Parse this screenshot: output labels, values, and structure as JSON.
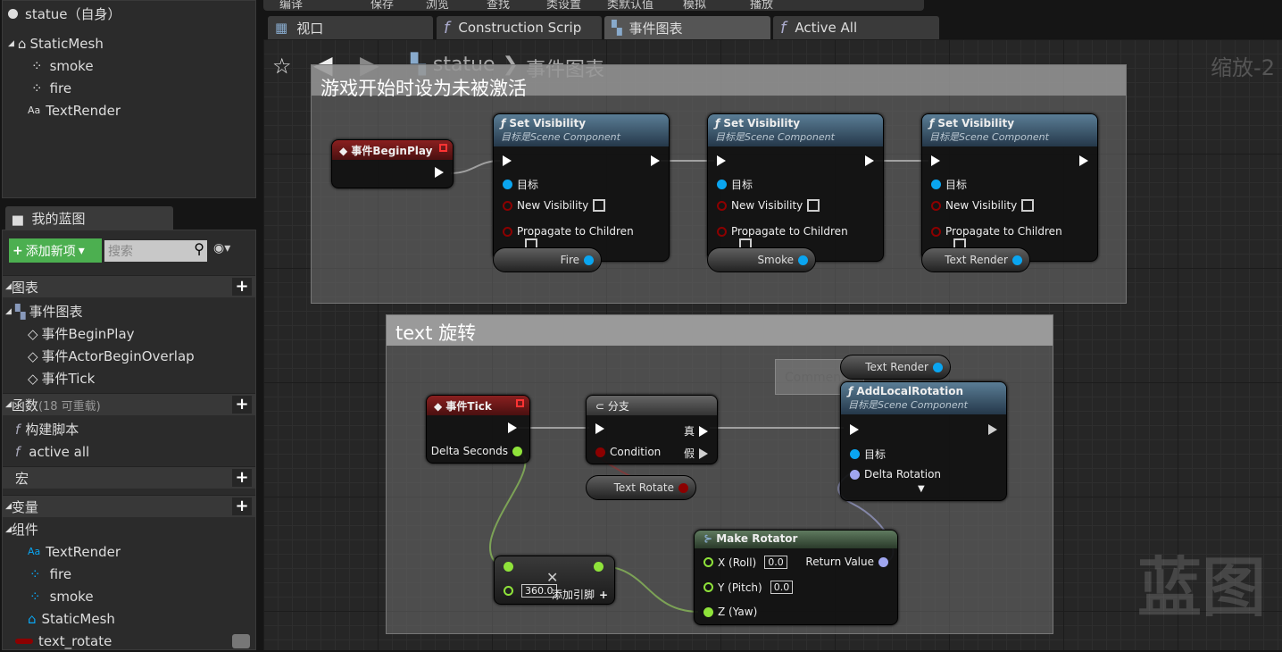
{
  "toolbar": [
    "编译",
    "保存",
    "浏览",
    "查找",
    "类设置",
    "类默认值",
    "模拟",
    "播放"
  ],
  "components": {
    "root": "statue（自身）",
    "items": [
      "StaticMesh",
      "smoke",
      "fire",
      "TextRender"
    ]
  },
  "my_blueprint": {
    "tab": "我的蓝图",
    "add_new": "添加新项",
    "search_placeholder": "搜索",
    "graphs": {
      "label": "图表",
      "event_graph": "事件图表",
      "events": [
        "事件BeginPlay",
        "事件ActorBeginOverlap",
        "事件Tick"
      ]
    },
    "functions": {
      "label": "函数",
      "override": "(18 可重载)",
      "items": [
        "构建脚本",
        "active all"
      ]
    },
    "macros": {
      "label": "宏"
    },
    "variables": {
      "label": "变量",
      "components_label": "组件",
      "items": [
        "TextRender",
        "fire",
        "smoke",
        "StaticMesh",
        "text_rotate"
      ]
    }
  },
  "tabs": [
    "视口",
    "Construction Scrip",
    "事件图表",
    "Active All"
  ],
  "active_tab": "事件图表",
  "breadcrumb": {
    "root": "statue",
    "sep": "❯",
    "current": "事件图表"
  },
  "zoom": "缩放-2",
  "watermark": "蓝图",
  "comment1": {
    "title": "游戏开始时设为未被激活",
    "begin_play": "事件BeginPlay",
    "set_nodes": [
      {
        "title": "Set Visibility",
        "subtitle": "目标是Scene Component",
        "target": "目标",
        "vis": "New Visibility",
        "prop": "Propagate to Children",
        "var": "Fire"
      },
      {
        "title": "Set Visibility",
        "subtitle": "目标是Scene Component",
        "target": "目标",
        "vis": "New Visibility",
        "prop": "Propagate to Children",
        "var": "Smoke"
      },
      {
        "title": "Set Visibility",
        "subtitle": "目标是Scene Component",
        "target": "目标",
        "vis": "New Visibility",
        "prop": "Propagate to Children",
        "var": "Text Render"
      }
    ]
  },
  "comment2": {
    "title": "text 旋转",
    "ghost": "Comment",
    "tick": {
      "title": "事件Tick",
      "delta": "Delta Seconds"
    },
    "branch": {
      "title": "分支",
      "condition": "Condition",
      "true": "真",
      "false": "假"
    },
    "text_rotate_var": "Text Rotate",
    "text_render_var": "Text Render",
    "add_rot": {
      "title": "AddLocalRotation",
      "subtitle": "目标是Scene Component",
      "target": "目标",
      "delta": "Delta Rotation"
    },
    "multiply": {
      "value": "360.0",
      "add_pin": "添加引脚"
    },
    "make_rot": {
      "title": "Make Rotator",
      "x": "X (Roll)",
      "x_val": "0.0",
      "y": "Y (Pitch)",
      "y_val": "0.0",
      "z": "Z (Yaw)",
      "ret": "Return Value"
    }
  },
  "colors": {
    "exec": "#ffffff",
    "object": "#0aa5f0",
    "bool": "#8c0000",
    "float": "#8fe33a",
    "rotator": "#a0a6f0",
    "add_button": "#4caf50"
  }
}
